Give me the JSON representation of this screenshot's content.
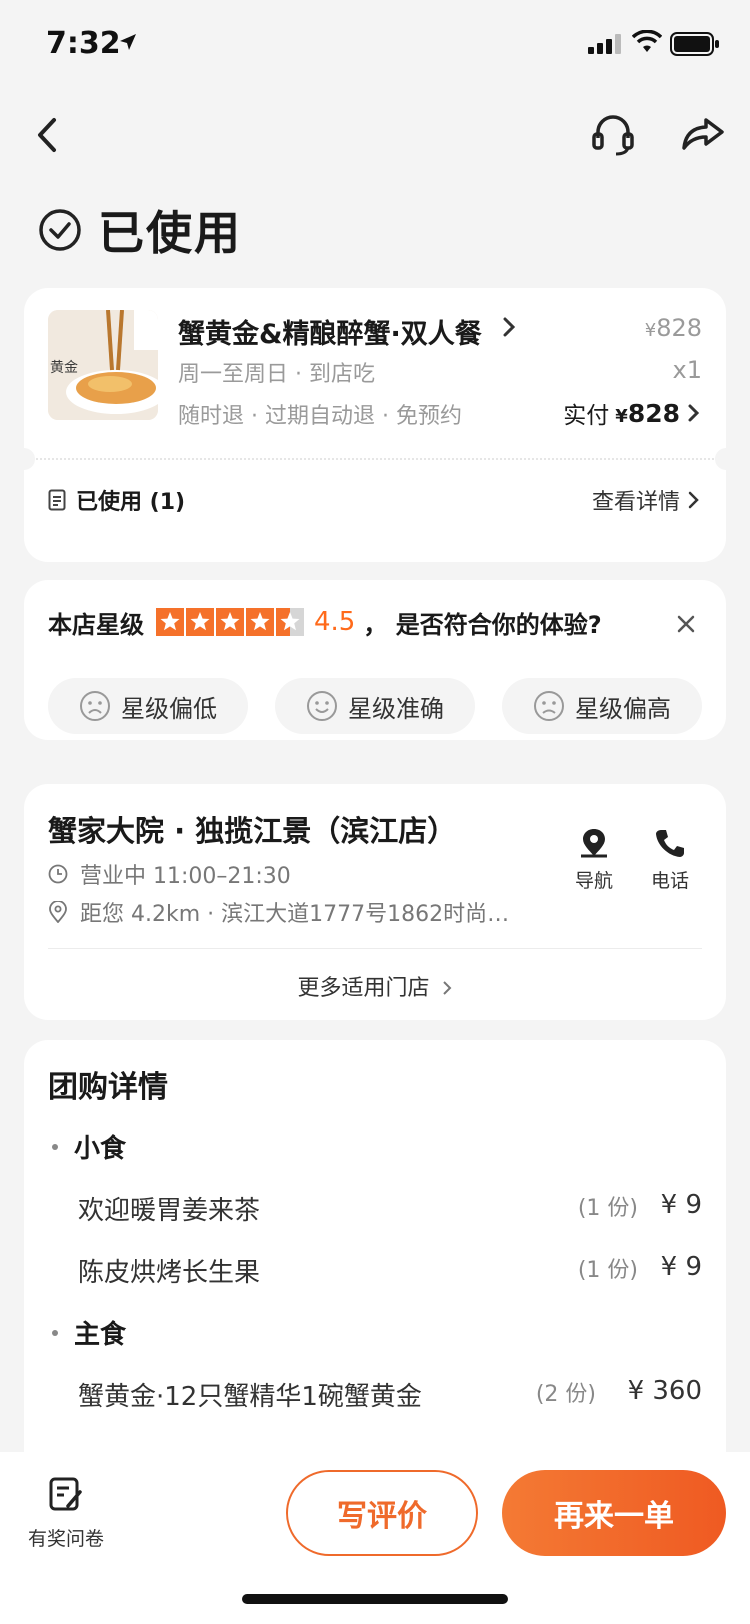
{
  "status_bar": {
    "time": "7:32"
  },
  "page": {
    "status_title": "已使用"
  },
  "order": {
    "product_name": "蟹黄金&精酿醉蟹·双人餐",
    "subtitle": "周一至周日 · 到店吃",
    "tags": "随时退 · 过期自动退 · 免预约",
    "currency": "¥",
    "original_price": "828",
    "quantity": "x1",
    "paid_label": "实付",
    "paid_amount": "828",
    "used_label": "已使用 (1)",
    "view_details": "查看详情",
    "thumb_text": "黄金"
  },
  "rating": {
    "label": "本店星级",
    "score": "4.5",
    "stars_value": 4.5,
    "question": "，  是否符合你的体验?",
    "options": [
      "星级偏低",
      "星级准确",
      "星级偏高"
    ]
  },
  "store": {
    "name": "蟹家大院 · 独揽江景（滨江店）",
    "hours": "营业中 11:00–21:30",
    "address": "距您 4.2km ·  滨江大道1777号1862时尚…",
    "nav_label": "导航",
    "call_label": "电话",
    "more_stores": "更多适用门店"
  },
  "deal": {
    "title": "团购详情",
    "sections": [
      {
        "name": "小食",
        "items": [
          {
            "name": "欢迎暖胃姜来茶",
            "count": "(1 份)",
            "price": "¥ 9"
          },
          {
            "name": "陈皮烘烤长生果",
            "count": "(1 份)",
            "price": "¥ 9"
          }
        ]
      },
      {
        "name": "主食",
        "items": [
          {
            "name": "蟹黄金·12只蟹精华1碗蟹黄金",
            "count": "(2 份)",
            "price": "¥ 360"
          }
        ]
      }
    ]
  },
  "bottom": {
    "survey_label": "有奖问卷",
    "review_button": "写评价",
    "reorder_button": "再来一单"
  },
  "colors": {
    "accent": "#ef6a2b",
    "star": "#f5712a"
  }
}
